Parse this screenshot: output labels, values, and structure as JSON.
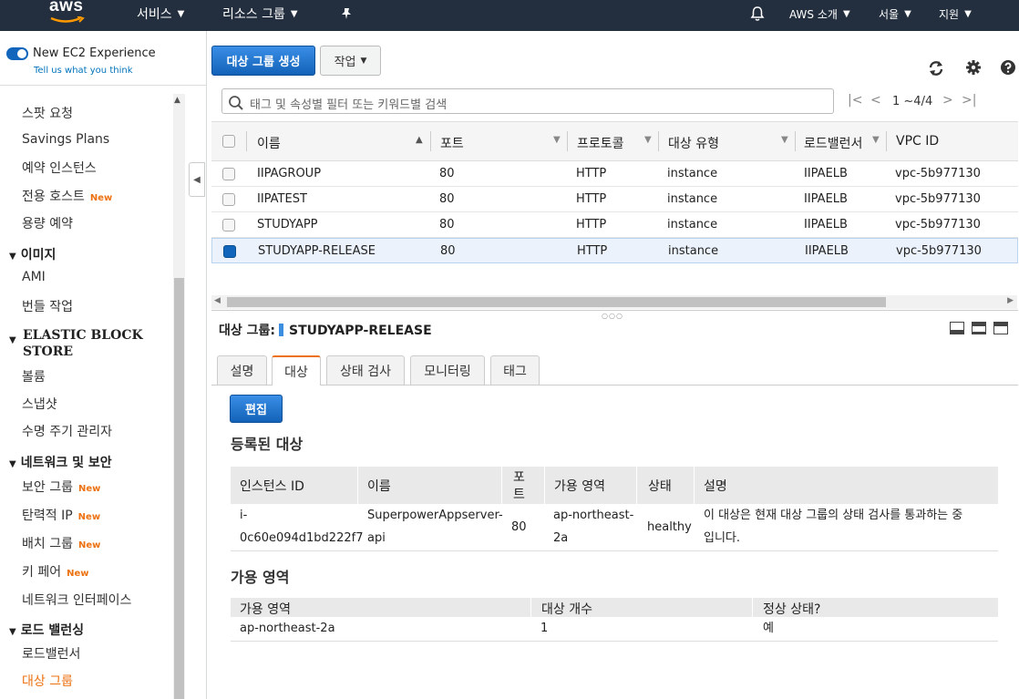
{
  "topbar": {
    "logo": "aws",
    "services": "서비스",
    "resource_groups": "리소스 그룹",
    "account": "AWS 소개",
    "region": "서울",
    "support": "지원"
  },
  "sidebar": {
    "ec2_experience": "New EC2 Experience",
    "tell_us": "Tell us what you think",
    "new_badge": "New",
    "items": {
      "spot": "스팟 요청",
      "savings": "Savings Plans",
      "reserved": "예약 인스턴스",
      "dedicated": "전용 호스트",
      "capacity": "용량 예약",
      "images": "이미지",
      "ami": "AMI",
      "bundle": "번들 작업",
      "ebs_line1": "ELASTIC BLOCK",
      "ebs_line2": "STORE",
      "volumes": "볼륨",
      "snapshots": "스냅샷",
      "lifecycle": "수명 주기 관리자",
      "network_security": "네트워크 및 보안",
      "security_groups": "보안 그룹",
      "elastic_ip": "탄력적 IP",
      "placement": "배치 그룹",
      "key_pairs": "키 페어",
      "interfaces": "네트워크 인터페이스",
      "load_balancing": "로드 밸런싱",
      "load_balancers": "로드밸런서",
      "target_groups": "대상 그룹"
    }
  },
  "toolbar": {
    "create": "대상 그룹 생성",
    "actions": "작업",
    "filter_placeholder": "태그 및 속성별 필터 또는 키워드별 검색",
    "pagination": "1 ~4/4"
  },
  "table": {
    "columns": [
      "이름",
      "포트",
      "프로토콜",
      "대상 유형",
      "로드밸런서",
      "VPC ID"
    ],
    "rows": [
      {
        "name": "IIPAGROUP",
        "port": "80",
        "protocol": "HTTP",
        "type": "instance",
        "lb": "IIPAELB",
        "vpc": "vpc-5b977130",
        "selected": false
      },
      {
        "name": "IIPATEST",
        "port": "80",
        "protocol": "HTTP",
        "type": "instance",
        "lb": "IIPAELB",
        "vpc": "vpc-5b977130",
        "selected": false
      },
      {
        "name": "STUDYAPP",
        "port": "80",
        "protocol": "HTTP",
        "type": "instance",
        "lb": "IIPAELB",
        "vpc": "vpc-5b977130",
        "selected": false
      },
      {
        "name": "STUDYAPP-RELEASE",
        "port": "80",
        "protocol": "HTTP",
        "type": "instance",
        "lb": "IIPAELB",
        "vpc": "vpc-5b977130",
        "selected": true
      }
    ]
  },
  "detail": {
    "label": "대상 그룹:",
    "name": "STUDYAPP-RELEASE",
    "tabs": [
      "설명",
      "대상",
      "상태 검사",
      "모니터링",
      "태그"
    ],
    "active_tab": "대상",
    "edit": "편집",
    "registered_title": "등록된 대상",
    "registered_columns": {
      "instance_id": "인스턴스 ID",
      "name": "이름",
      "port_1": "포",
      "port_2": "트",
      "az": "가용 영역",
      "status": "상태",
      "description": "설명"
    },
    "registered_row": {
      "instance_id_1": "i-",
      "instance_id_2": "0c60e094d1bd222f7",
      "name_1": "SuperpowerAppserver-",
      "name_2": "api",
      "port": "80",
      "az_1": "ap-northeast-",
      "az_2": "2a",
      "status": "healthy",
      "description_1": "이 대상은 현재 대상 그룹의 상태 검사를 통과하는 중",
      "description_2": "입니다."
    },
    "az_title": "가용 영역",
    "az_columns": {
      "az": "가용 영역",
      "count": "대상 개수",
      "healthy": "정상 상태?"
    },
    "az_row": {
      "az": "ap-northeast-2a",
      "count": "1",
      "healthy": "예"
    }
  },
  "colors": {
    "topbar": "#232f3e",
    "primary": "#1f6fc5",
    "accent": "#ec7211",
    "link": "#0073bb"
  }
}
